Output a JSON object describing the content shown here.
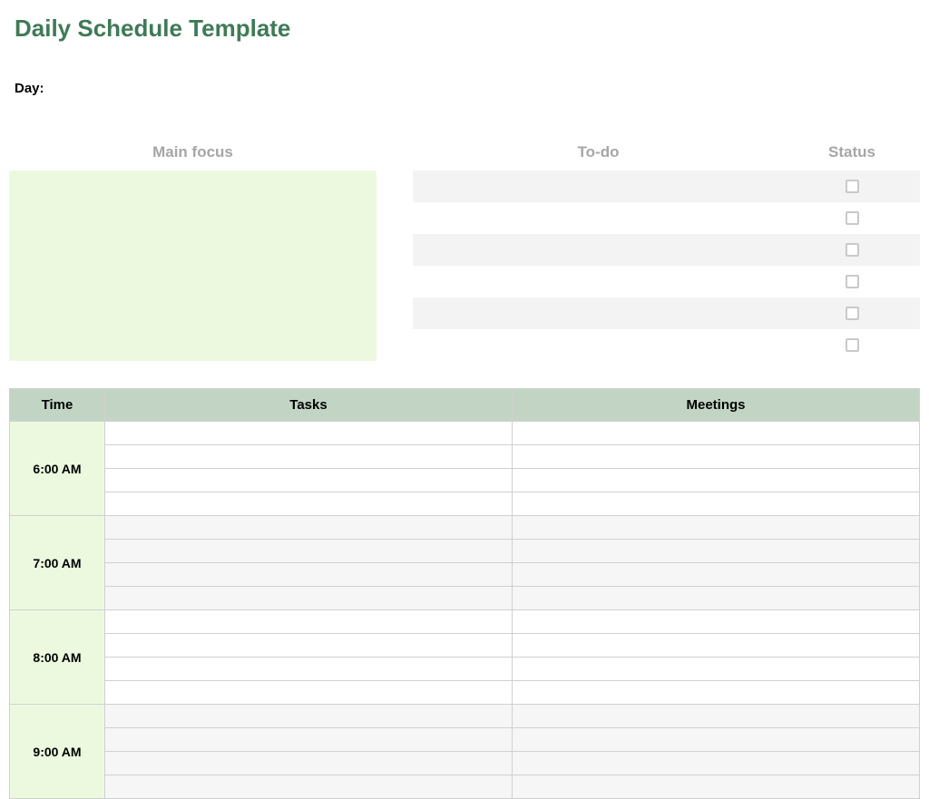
{
  "title": "Daily Schedule Template",
  "day_label": "Day:",
  "focus": {
    "header": "Main focus"
  },
  "todo": {
    "header": "To-do",
    "status_header": "Status",
    "rows": [
      "",
      "",
      "",
      "",
      "",
      ""
    ]
  },
  "schedule": {
    "headers": {
      "time": "Time",
      "tasks": "Tasks",
      "meetings": "Meetings"
    },
    "hours": [
      "6:00 AM",
      "7:00 AM",
      "8:00 AM",
      "9:00 AM"
    ]
  }
}
